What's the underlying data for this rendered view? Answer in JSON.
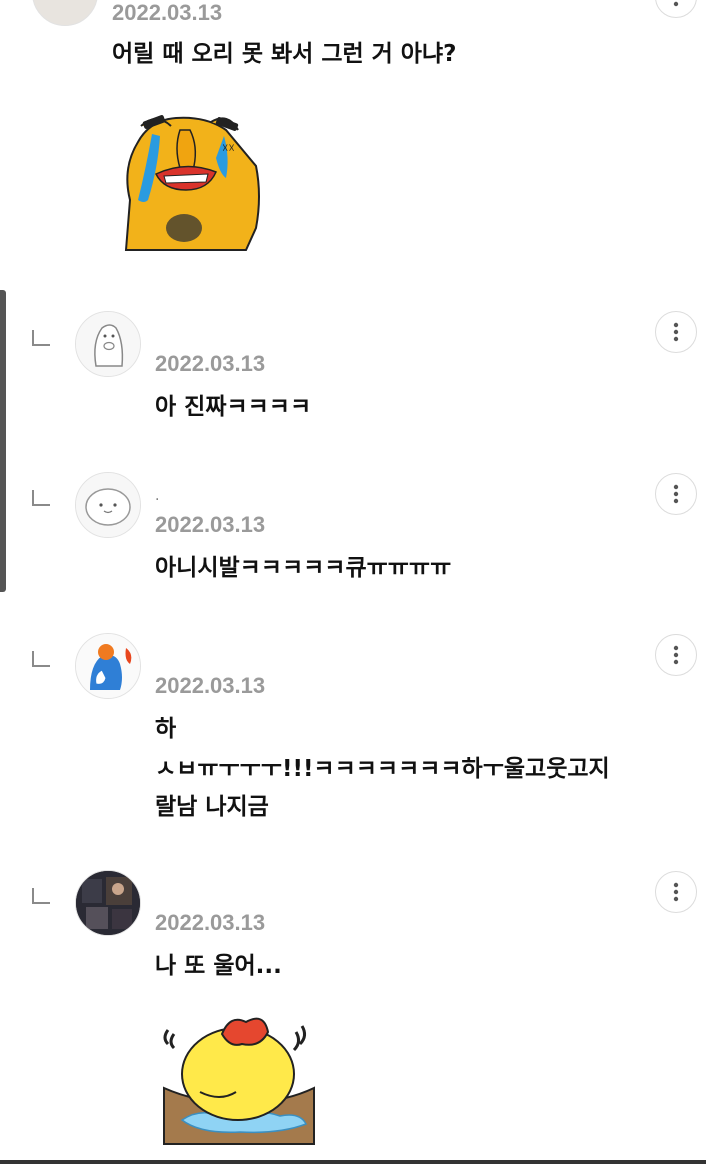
{
  "top_comment": {
    "date": "2022.03.13",
    "text": "어릴 때 오리 못 봐서 그런 거 아냐?",
    "sticker_icon": "crying-bear-sticker-icon"
  },
  "replies": [
    {
      "date": "2022.03.13",
      "name": "",
      "text": "아 진짜ㅋㅋㅋㅋ",
      "avatar_icon": "penguin-avatar-icon"
    },
    {
      "date": "2022.03.13",
      "name": ".",
      "text": "아니시발ㅋㅋㅋㅋㅋ큐ㅠㅠㅠㅠ",
      "avatar_icon": "blob-avatar-icon"
    },
    {
      "date": "2022.03.13",
      "name": "",
      "lines": [
        "하",
        "ㅅㅂㅠㅜㅜㅜ!!!ㅋㅋㅋㅋㅋㅋㅋ하ㅜ울고웃고지",
        "랄남 나지금"
      ],
      "avatar_icon": "blue-character-avatar-icon"
    },
    {
      "date": "2022.03.13",
      "name": "",
      "text": "나 또 울어...",
      "avatar_icon": "photo-avatar-icon",
      "sticker_icon": "crying-duck-sticker-icon"
    }
  ],
  "more_icon": "more-vertical-icon",
  "colors": {
    "date": "#9a9a9a",
    "text": "#111111",
    "bear": "#f2b21a",
    "tears": "#2a9be0",
    "duck": "#ffe94a"
  }
}
